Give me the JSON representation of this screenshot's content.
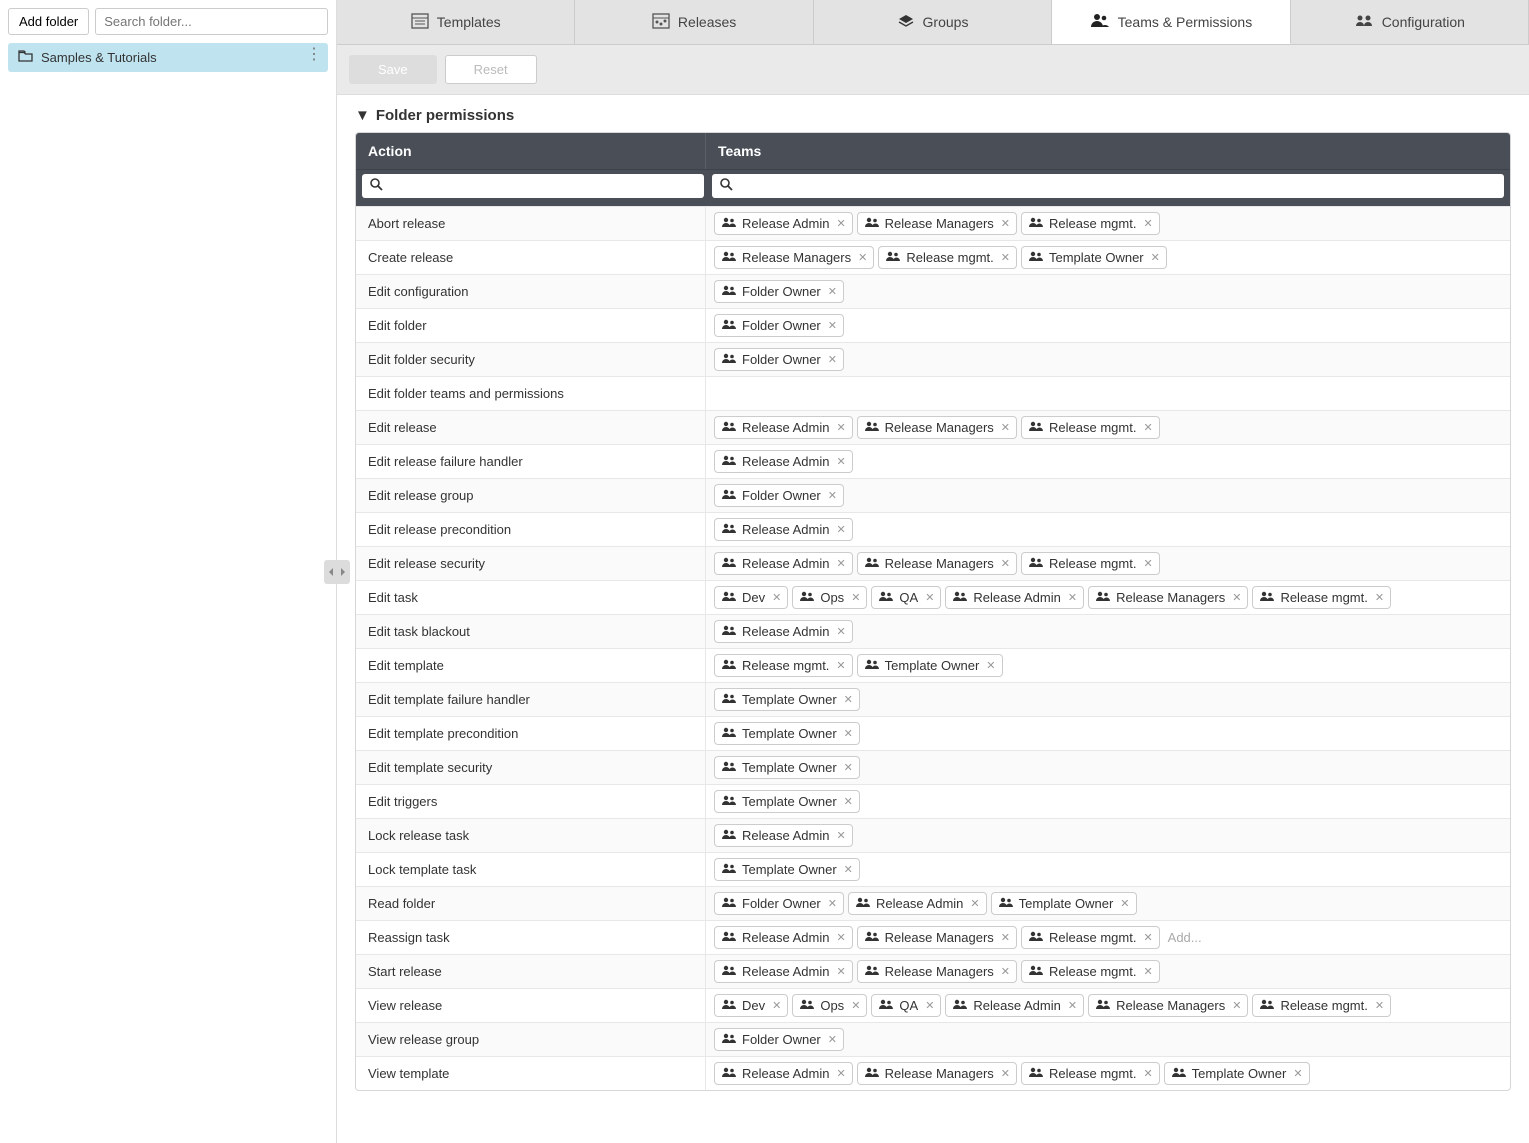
{
  "sidebar": {
    "add_folder_label": "Add folder",
    "search_placeholder": "Search folder...",
    "folder_name": "Samples & Tutorials"
  },
  "tabs": [
    {
      "label": "Templates",
      "active": false,
      "icon": "templates"
    },
    {
      "label": "Releases",
      "active": false,
      "icon": "releases"
    },
    {
      "label": "Groups",
      "active": false,
      "icon": "groups"
    },
    {
      "label": "Teams & Permissions",
      "active": true,
      "icon": "teams"
    },
    {
      "label": "Configuration",
      "active": false,
      "icon": "config"
    }
  ],
  "toolbar": {
    "save_label": "Save",
    "reset_label": "Reset"
  },
  "section_title": "Folder permissions",
  "table_headers": {
    "action": "Action",
    "teams": "Teams"
  },
  "add_placeholder": "Add...",
  "permissions": [
    {
      "action": "Abort release",
      "teams": [
        "Release Admin",
        "Release Managers",
        "Release mgmt."
      ]
    },
    {
      "action": "Create release",
      "teams": [
        "Release Managers",
        "Release mgmt.",
        "Template Owner"
      ]
    },
    {
      "action": "Edit configuration",
      "teams": [
        "Folder Owner"
      ]
    },
    {
      "action": "Edit folder",
      "teams": [
        "Folder Owner"
      ]
    },
    {
      "action": "Edit folder security",
      "teams": [
        "Folder Owner"
      ]
    },
    {
      "action": "Edit folder teams and permissions",
      "teams": []
    },
    {
      "action": "Edit release",
      "teams": [
        "Release Admin",
        "Release Managers",
        "Release mgmt."
      ]
    },
    {
      "action": "Edit release failure handler",
      "teams": [
        "Release Admin"
      ]
    },
    {
      "action": "Edit release group",
      "teams": [
        "Folder Owner"
      ]
    },
    {
      "action": "Edit release precondition",
      "teams": [
        "Release Admin"
      ]
    },
    {
      "action": "Edit release security",
      "teams": [
        "Release Admin",
        "Release Managers",
        "Release mgmt."
      ]
    },
    {
      "action": "Edit task",
      "teams": [
        "Dev",
        "Ops",
        "QA",
        "Release Admin",
        "Release Managers",
        "Release mgmt."
      ]
    },
    {
      "action": "Edit task blackout",
      "teams": [
        "Release Admin"
      ]
    },
    {
      "action": "Edit template",
      "teams": [
        "Release mgmt.",
        "Template Owner"
      ]
    },
    {
      "action": "Edit template failure handler",
      "teams": [
        "Template Owner"
      ]
    },
    {
      "action": "Edit template precondition",
      "teams": [
        "Template Owner"
      ]
    },
    {
      "action": "Edit template security",
      "teams": [
        "Template Owner"
      ]
    },
    {
      "action": "Edit triggers",
      "teams": [
        "Template Owner"
      ]
    },
    {
      "action": "Lock release task",
      "teams": [
        "Release Admin"
      ]
    },
    {
      "action": "Lock template task",
      "teams": [
        "Template Owner"
      ]
    },
    {
      "action": "Read folder",
      "teams": [
        "Folder Owner",
        "Release Admin",
        "Template Owner"
      ]
    },
    {
      "action": "Reassign task",
      "teams": [
        "Release Admin",
        "Release Managers",
        "Release mgmt."
      ],
      "show_add": true
    },
    {
      "action": "Start release",
      "teams": [
        "Release Admin",
        "Release Managers",
        "Release mgmt."
      ]
    },
    {
      "action": "View release",
      "teams": [
        "Dev",
        "Ops",
        "QA",
        "Release Admin",
        "Release Managers",
        "Release mgmt."
      ]
    },
    {
      "action": "View release group",
      "teams": [
        "Folder Owner"
      ]
    },
    {
      "action": "View template",
      "teams": [
        "Release Admin",
        "Release Managers",
        "Release mgmt.",
        "Template Owner"
      ]
    }
  ]
}
